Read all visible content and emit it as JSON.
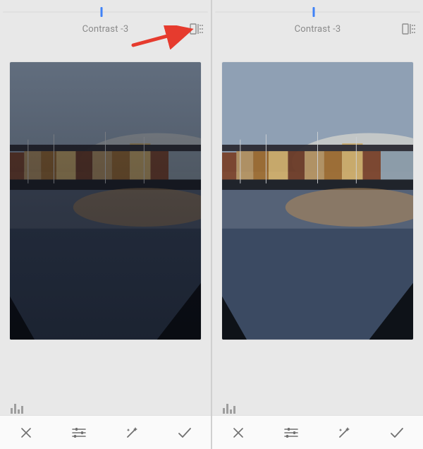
{
  "left": {
    "param_label": "Contrast -3",
    "slider_percent": 48,
    "compare_active": false
  },
  "right": {
    "param_label": "Contrast -3",
    "slider_percent": 48,
    "compare_active": true
  },
  "icons": {
    "compare": "compare-icon",
    "histogram": "histogram-icon",
    "close": "close-icon",
    "tune": "tune-icon",
    "wand": "auto-wand-icon",
    "accept": "check-icon"
  },
  "colors": {
    "accent": "#3f82f7",
    "arrow": "#e63b2e"
  }
}
